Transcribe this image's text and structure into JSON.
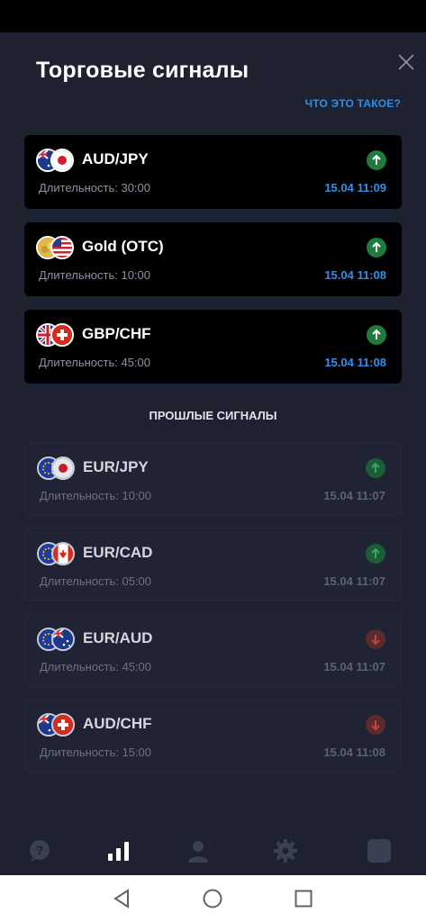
{
  "header": {
    "title": "Торговые сигналы",
    "what_link": "ЧТО ЭТО ТАКОЕ?"
  },
  "active_signals": [
    {
      "pair": "AUD/JPY",
      "duration": "Длительность: 30:00",
      "time": "15.04 11:09",
      "direction": "up",
      "flags": [
        "australia-flag-icon",
        "japan-flag-icon"
      ]
    },
    {
      "pair": "Gold (OTC)",
      "duration": "Длительность: 10:00",
      "time": "15.04 11:08",
      "direction": "up",
      "flags": [
        "gold-coin-icon",
        "usa-flag-icon"
      ]
    },
    {
      "pair": "GBP/CHF",
      "duration": "Длительность: 45:00",
      "time": "15.04 11:08",
      "direction": "up",
      "flags": [
        "uk-flag-icon",
        "switzerland-flag-icon"
      ]
    }
  ],
  "past_section_title": "ПРОШЛЫЕ СИГНАЛЫ",
  "past_signals": [
    {
      "pair": "EUR/JPY",
      "duration": "Длительность: 10:00",
      "time": "15.04 11:07",
      "direction": "up",
      "flags": [
        "eu-flag-icon",
        "japan-flag-icon"
      ]
    },
    {
      "pair": "EUR/CAD",
      "duration": "Длительность: 05:00",
      "time": "15.04 11:07",
      "direction": "up",
      "flags": [
        "eu-flag-icon",
        "canada-flag-icon"
      ]
    },
    {
      "pair": "EUR/AUD",
      "duration": "Длительность: 45:00",
      "time": "15.04 11:07",
      "direction": "down",
      "flags": [
        "eu-flag-icon",
        "australia-flag-icon"
      ]
    },
    {
      "pair": "AUD/CHF",
      "duration": "Длительность: 15:00",
      "time": "15.04 11:08",
      "direction": "down",
      "flags": [
        "australia-flag-icon",
        "switzerland-flag-icon"
      ]
    }
  ],
  "bottom_nav": [
    "help-icon",
    "signals-bars-icon",
    "profile-icon",
    "settings-gear-icon",
    "square-icon"
  ],
  "colors": {
    "accent_blue": "#2f8ee8",
    "up_green": "#1e7b3c",
    "down_red": "#6b2b2b",
    "background": "#1d2130",
    "active_card": "#000000"
  }
}
